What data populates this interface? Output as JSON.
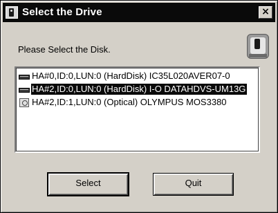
{
  "window": {
    "title": "Select the Drive",
    "close_label": "×"
  },
  "prompt": "Please Select the Disk.",
  "drives": [
    {
      "label": "HA#0,ID:0,LUN:0 (HardDisk) IC35L020AVER07-0",
      "icon": "harddisk-icon",
      "selected": false
    },
    {
      "label": "HA#2,ID:0,LUN:0 (HardDisk) I-O DATAHDVS-UM13G",
      "icon": "harddisk-icon",
      "selected": true
    },
    {
      "label": "HA#2,ID:1,LUN:0 (Optical) OLYMPUS MOS3380",
      "icon": "optical-drive-icon",
      "selected": false
    }
  ],
  "buttons": {
    "select": "Select",
    "quit": "Quit"
  }
}
